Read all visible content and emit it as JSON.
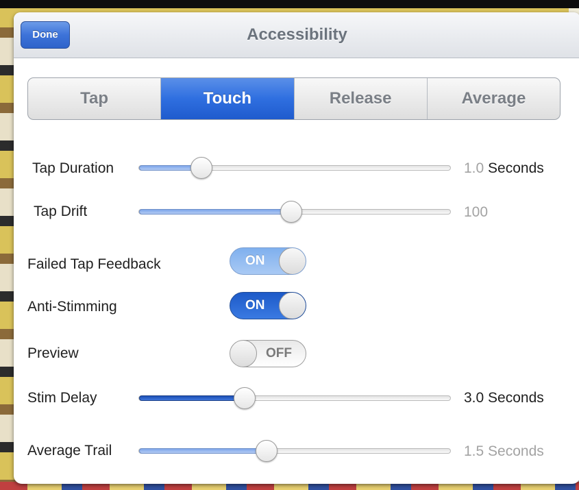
{
  "navbar": {
    "title": "Accessibility",
    "done_label": "Done"
  },
  "segments": {
    "items": [
      "Tap",
      "Touch",
      "Release",
      "Average"
    ],
    "selected": "Touch"
  },
  "sliders": {
    "tap_duration": {
      "label": "Tap Duration",
      "value_number": "1.0",
      "value_unit": "Seconds",
      "level": 0.2
    },
    "tap_drift": {
      "label": "Tap Drift",
      "value": "100",
      "level": 0.49
    },
    "stim_delay": {
      "label": "Stim Delay",
      "value": "3.0 Seconds",
      "level": 0.34
    },
    "average_trail": {
      "label": "Average Trail",
      "value": "1.5 Seconds",
      "level": 0.41
    }
  },
  "toggles": {
    "failed_tap_feedback": {
      "label": "Failed Tap Feedback",
      "state": "ON"
    },
    "anti_stimming": {
      "label": "Anti-Stimming",
      "state": "ON"
    },
    "preview": {
      "label": "Preview",
      "state": "OFF"
    }
  },
  "colors": {
    "accent": "#2f6fe0",
    "done_button": "#3d73d9",
    "slider_fill_light": "#9dbcf0",
    "slider_fill_dark": "#1f56c0",
    "nav_title": "#6b737d"
  }
}
